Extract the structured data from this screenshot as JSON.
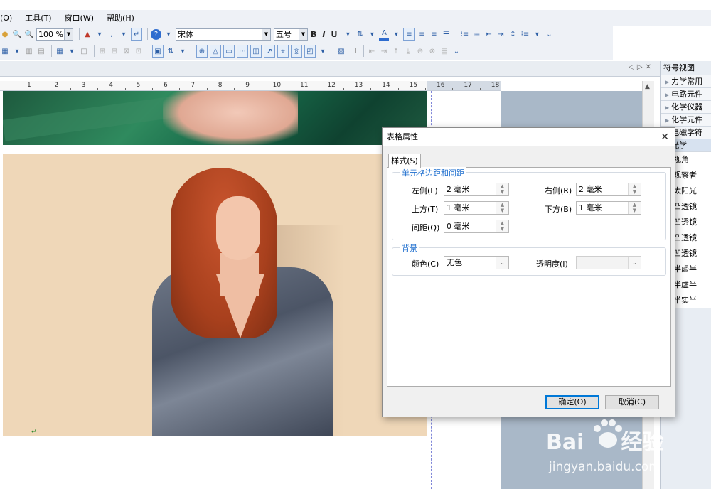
{
  "menu": [
    "(O)",
    "工具(T)",
    "窗口(W)",
    "帮助(H)"
  ],
  "toolbar": {
    "zoom": "100 %",
    "font_name": "宋体",
    "font_size": "五号",
    "bold": "B",
    "italic": "I",
    "underline": "U"
  },
  "ruler": {
    "ticks": [
      "1",
      "2",
      "3",
      "4",
      "5",
      "6",
      "7",
      "8",
      "9",
      "10",
      "11",
      "12",
      "13",
      "14",
      "15",
      "16",
      "17",
      "18"
    ]
  },
  "sidebar": {
    "title": "符号视图",
    "categories": [
      "力学常用",
      "电路元件",
      "化学仪器",
      "化学元件",
      "电磁学符",
      "光学"
    ],
    "open_category": "光学",
    "items": [
      "视角",
      "观察者",
      "太阳光",
      "凸透镜",
      "凹透镜",
      "凸透镜",
      "凹透镜",
      "半虚半",
      "半虚半",
      "半实半"
    ]
  },
  "dialog": {
    "title": "表格属性",
    "tab": "样式(S)",
    "group_margin": "单元格边距和间距",
    "left_label": "左侧(L)",
    "left_value": "2 毫米",
    "right_label": "右侧(R)",
    "right_value": "2 毫米",
    "top_label": "上方(T)",
    "top_value": "1 毫米",
    "bottom_label": "下方(B)",
    "bottom_value": "1 毫米",
    "spacing_label": "间距(Q)",
    "spacing_value": "0 毫米",
    "group_bg": "背景",
    "color_label": "颜色(C)",
    "color_value": "无色",
    "opacity_label": "透明度(I)",
    "opacity_value": "",
    "ok": "确定(O)",
    "cancel": "取消(C)"
  },
  "watermark": {
    "brand_a": "Bai",
    "brand_b": "经验",
    "site": "jingyan.baidu.com"
  }
}
